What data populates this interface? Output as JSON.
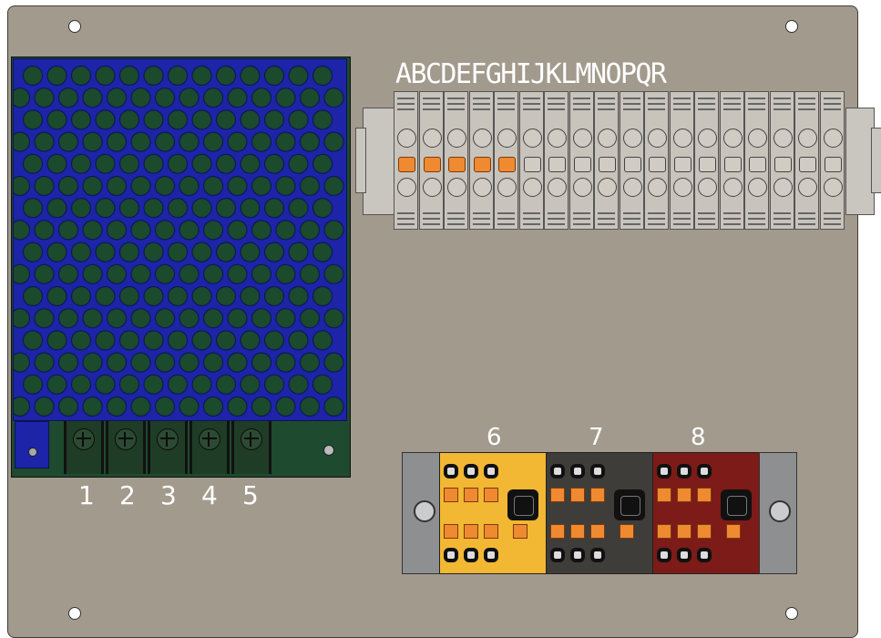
{
  "psu": {
    "terminal_labels": [
      "1",
      "2",
      "3",
      "4",
      "5"
    ]
  },
  "terminal_strip": {
    "letters": "ABCDEFGHIJKLMNOPQR",
    "jumpered_count": 5
  },
  "distribution_block": {
    "module_labels": [
      "6",
      "7",
      "8"
    ]
  },
  "colors": {
    "plate": "#a29a8d",
    "psu_cover": "#1d24a8",
    "module_yellow": "#f2b733",
    "module_dark": "#3f3d3a",
    "module_red": "#7c1b17",
    "lever_orange": "#f08a30"
  }
}
